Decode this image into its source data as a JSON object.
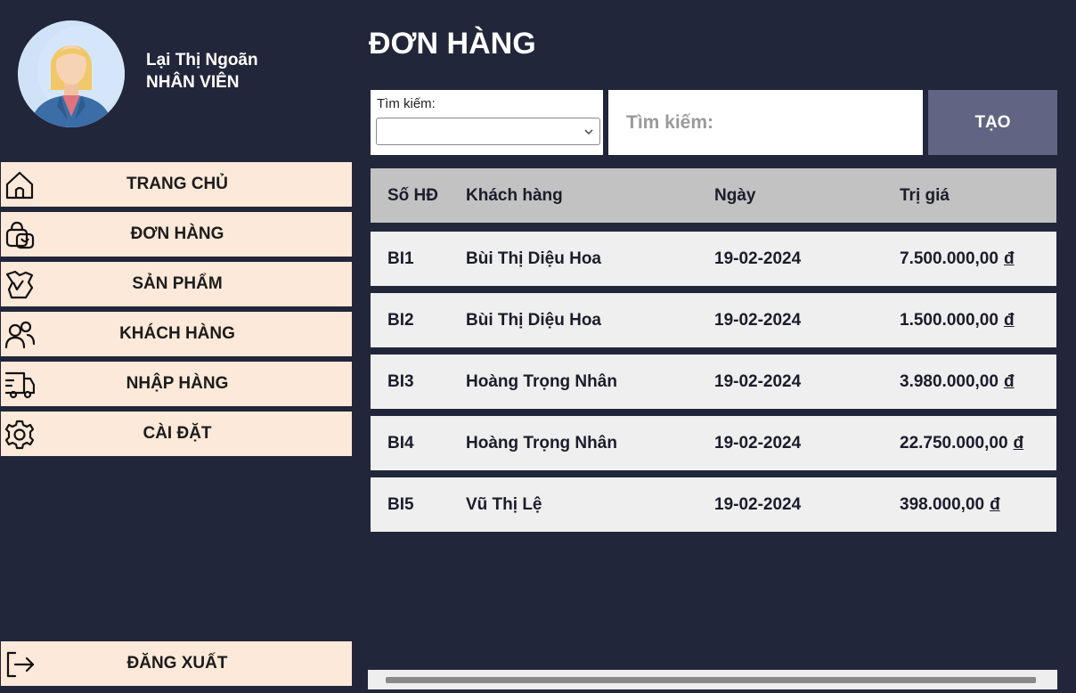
{
  "user": {
    "name": "Lại Thị Ngoãn",
    "role": "NHÂN VIÊN"
  },
  "sidebar": {
    "items": [
      {
        "label": "TRANG CHỦ",
        "icon": "home-icon"
      },
      {
        "label": "ĐƠN HÀNG",
        "icon": "shopping-bag-icon"
      },
      {
        "label": "SẢN PHẨM",
        "icon": "box-icon"
      },
      {
        "label": "KHÁCH HÀNG",
        "icon": "users-icon"
      },
      {
        "label": "NHẬP HÀNG",
        "icon": "truck-icon"
      },
      {
        "label": "CÀI ĐẶT",
        "icon": "gear-icon"
      }
    ],
    "logout": {
      "label": "ĐĂNG XUẤT",
      "icon": "logout-icon"
    }
  },
  "main": {
    "title": "ĐƠN HÀNG",
    "filter": {
      "label": "Tìm kiếm:",
      "selected": ""
    },
    "search": {
      "placeholder": "Tìm kiếm:"
    },
    "create_label": "TẠO",
    "table": {
      "columns": [
        "Số HĐ",
        "Khách hàng",
        "Ngày",
        "Trị giá"
      ],
      "currency_symbol": "đ",
      "rows": [
        {
          "id": "BI1",
          "customer": "Bùi Thị Diệu Hoa",
          "date": "19-02-2024",
          "value": "7.500.000,00"
        },
        {
          "id": "BI2",
          "customer": "Bùi Thị Diệu Hoa",
          "date": "19-02-2024",
          "value": "1.500.000,00"
        },
        {
          "id": "BI3",
          "customer": "Hoàng Trọng Nhân",
          "date": "19-02-2024",
          "value": "3.980.000,00"
        },
        {
          "id": "BI4",
          "customer": "Hoàng Trọng Nhân",
          "date": "19-02-2024",
          "value": "22.750.000,00"
        },
        {
          "id": "BI5",
          "customer": "Vũ Thị Lệ",
          "date": "19-02-2024",
          "value": "398.000,00"
        }
      ]
    }
  },
  "colors": {
    "background": "#22263a",
    "nav_item": "#fde9d9",
    "button": "#616482",
    "table_header": "#c2c2c2",
    "row": "#efefef"
  }
}
